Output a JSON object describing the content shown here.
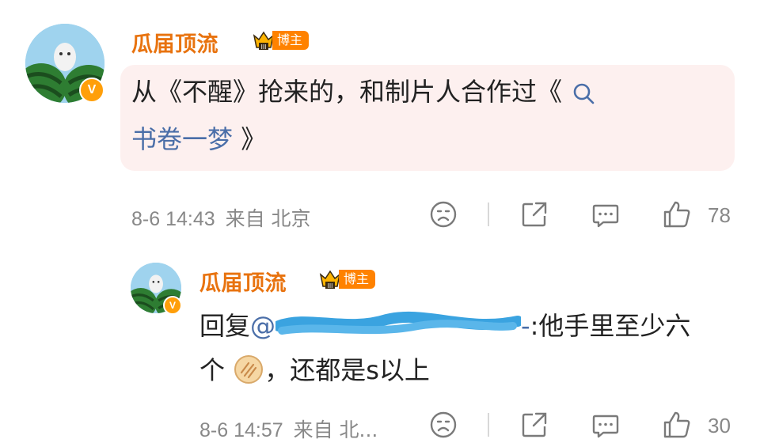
{
  "comment": {
    "author": "瓜届顶流",
    "badge": "博主",
    "text_line1": "从《不醒》抢来的，和制片人合作过《",
    "text_line2_link": "书卷一梦",
    "text_line2_end": " 》",
    "time": "8-6 14:43",
    "source": "来自 北京",
    "likes": "78"
  },
  "reply": {
    "author": "瓜届顶流",
    "badge": "博主",
    "prefix": "回复",
    "mention": "@",
    "mention_suffix": "-",
    "text_after": ":他手里至少六",
    "line2_start": "个",
    "line2_end": "，还都是s以上",
    "time": "8-6 14:57",
    "source": "来自 北...",
    "likes": "30"
  },
  "icons": [
    "search-icon",
    "sad-face-icon",
    "share-icon",
    "comment-icon",
    "like-icon",
    "crown-icon",
    "verified-icon",
    "pancake-emoji"
  ],
  "colors": {
    "name": "#e8730f",
    "badge": "#ff8200",
    "link": "#4a6ea8",
    "bubble": "#fdf0ef",
    "verified": "#ff9f0a"
  }
}
